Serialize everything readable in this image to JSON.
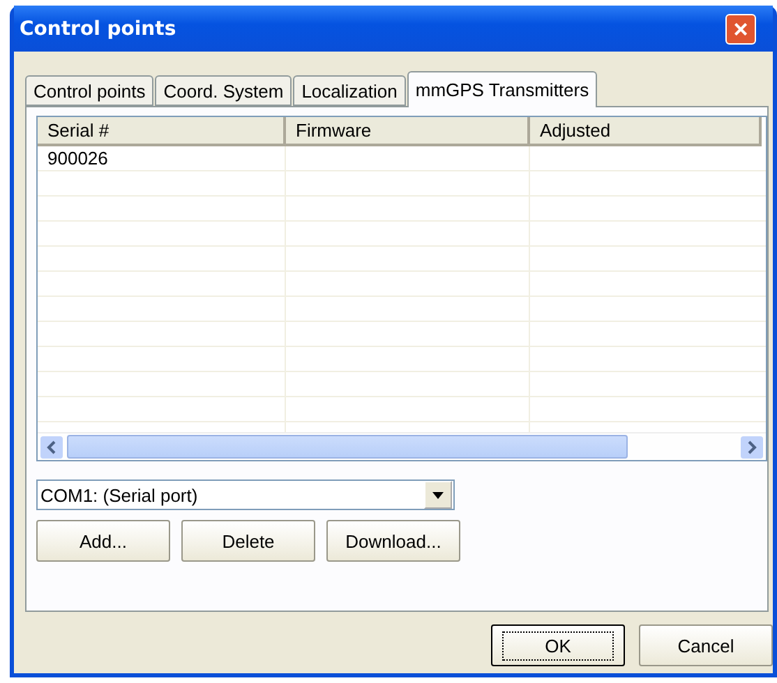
{
  "window": {
    "title": "Control points",
    "close": "×"
  },
  "tabs": [
    {
      "label": "Control points",
      "selected": false
    },
    {
      "label": "Coord. System",
      "selected": false
    },
    {
      "label": "Localization",
      "selected": false
    },
    {
      "label": "mmGPS Transmitters",
      "selected": true
    }
  ],
  "table": {
    "columns": [
      "Serial #",
      "Firmware",
      "Adjusted"
    ],
    "rows": [
      [
        "900026",
        "",
        ""
      ]
    ]
  },
  "port_select": {
    "value": "COM1: (Serial port)"
  },
  "actions": [
    "Add...",
    "Delete",
    "Download..."
  ],
  "buttons": [
    {
      "label": "OK",
      "default": true
    },
    {
      "label": "Cancel",
      "default": false
    }
  ]
}
